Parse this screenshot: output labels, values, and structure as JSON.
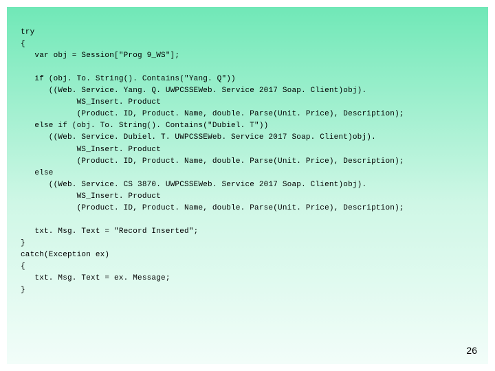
{
  "code": {
    "lines": [
      "try",
      "{",
      "   var obj = Session[\"Prog 9_WS\"];",
      "",
      "   if (obj. To. String(). Contains(\"Yang. Q\"))",
      "      ((Web. Service. Yang. Q. UWPCSSEWeb. Service 2017 Soap. Client)obj).",
      "            WS_Insert. Product",
      "            (Product. ID, Product. Name, double. Parse(Unit. Price), Description);",
      "   else if (obj. To. String(). Contains(\"Dubiel. T\"))",
      "      ((Web. Service. Dubiel. T. UWPCSSEWeb. Service 2017 Soap. Client)obj).",
      "            WS_Insert. Product",
      "            (Product. ID, Product. Name, double. Parse(Unit. Price), Description);",
      "   else",
      "      ((Web. Service. CS 3870. UWPCSSEWeb. Service 2017 Soap. Client)obj).",
      "            WS_Insert. Product",
      "            (Product. ID, Product. Name, double. Parse(Unit. Price), Description);",
      "",
      "   txt. Msg. Text = \"Record Inserted\";",
      "}",
      "catch(Exception ex)",
      "{",
      "   txt. Msg. Text = ex. Message;",
      "}"
    ]
  },
  "page_number": "26"
}
